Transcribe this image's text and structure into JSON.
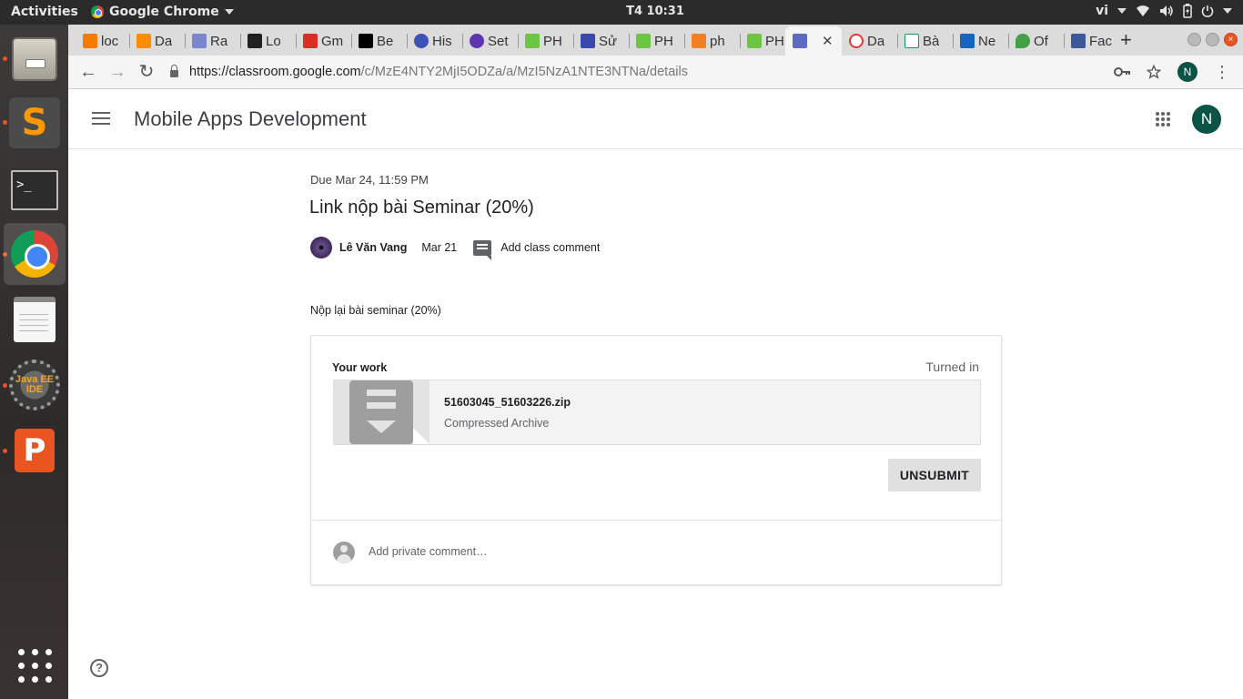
{
  "topbar": {
    "activities": "Activities",
    "app_menu": "Google Chrome",
    "clock": "T4 10:31",
    "language": "vi",
    "tray_icons": [
      "wifi-icon",
      "volume-icon",
      "battery-icon",
      "power-icon"
    ]
  },
  "dock": {
    "items": [
      {
        "name": "files",
        "running": true
      },
      {
        "name": "sublime-text",
        "running": true
      },
      {
        "name": "terminal",
        "running": false
      },
      {
        "name": "google-chrome",
        "running": true,
        "active": true
      },
      {
        "name": "text-editor",
        "running": false
      },
      {
        "name": "eclipse-java-ee",
        "running": true,
        "label": "Java EE IDE"
      },
      {
        "name": "impress",
        "running": true
      },
      {
        "name": "show-applications",
        "running": false
      }
    ]
  },
  "browser": {
    "tabs": [
      {
        "label": "loc",
        "color": "#f57c00"
      },
      {
        "label": "Da",
        "color": "#fb8c00"
      },
      {
        "label": "Ra",
        "color": "#7986cb"
      },
      {
        "label": "Lo",
        "color": "#212121"
      },
      {
        "label": "Gm",
        "color": "#d93025"
      },
      {
        "label": "Be",
        "color": "#000000"
      },
      {
        "label": "His",
        "color": "#3f51b5"
      },
      {
        "label": "Set",
        "color": "#5e35b1"
      },
      {
        "label": "PH",
        "color": "#6cc644"
      },
      {
        "label": "Sử",
        "color": "#3949ab"
      },
      {
        "label": "PH",
        "color": "#6cc644"
      },
      {
        "label": "ph",
        "color": "#f48024"
      },
      {
        "label": "PH",
        "color": "#6cc644"
      },
      {
        "label": "",
        "color": "#5c6bc0",
        "active": true
      },
      {
        "label": "Da",
        "color": "#e53935"
      },
      {
        "label": "Bà",
        "color": "#0f9d58"
      },
      {
        "label": "Ne",
        "color": "#1565c0"
      },
      {
        "label": "Of",
        "color": "#43a047"
      },
      {
        "label": "Fac",
        "color": "#3b5998"
      }
    ],
    "url_host": "https://classroom.google.com",
    "url_path": "/c/MzE4NTY2MjI5ODZa/a/MzI5NzA1NTE3NTNa/details",
    "profile_initial": "N"
  },
  "classroom": {
    "class_name": "Mobile Apps Development",
    "profile_initial": "N",
    "due": "Due Mar 24, 11:59 PM",
    "title": "Link nộp bài Seminar (20%)",
    "teacher": "Lê Văn Vang",
    "posted_date": "Mar 21",
    "add_class_comment": "Add class comment",
    "description": "Nộp lại bài seminar (20%)",
    "work": {
      "heading": "Your work",
      "status": "Turned in",
      "file_name": "51603045_51603226.zip",
      "file_type": "Compressed Archive",
      "unsubmit_label": "UNSUBMIT",
      "private_comment_placeholder": "Add private comment…"
    },
    "help": "?"
  }
}
